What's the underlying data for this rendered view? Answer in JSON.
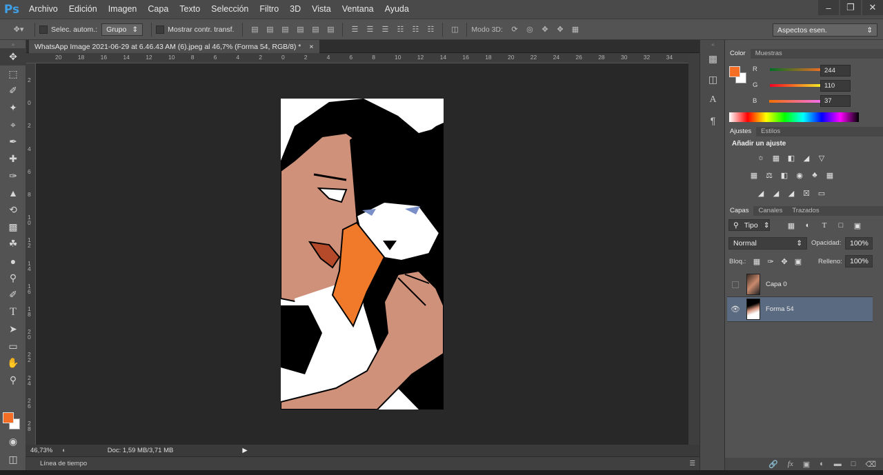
{
  "app": {
    "logo": "Ps"
  },
  "menu": [
    "Archivo",
    "Edición",
    "Imagen",
    "Capa",
    "Texto",
    "Selección",
    "Filtro",
    "3D",
    "Vista",
    "Ventana",
    "Ayuda"
  ],
  "window_controls": [
    "minimize-icon",
    "restore-icon",
    "close-icon"
  ],
  "options": {
    "auto_select_label": "Selec. autom.:",
    "auto_select_value": "Grupo",
    "transform_label": "Mostrar contr. transf.",
    "mode3d_label": "Modo 3D:",
    "workspace": "Aspectos esen."
  },
  "document": {
    "tab_title": "WhatsApp Image 2021-06-29 at 6.46.43 AM (6).jpeg al 46,7% (Forma 54, RGB/8) *",
    "zoom": "46,73%",
    "doc_size": "Doc: 1,59 MB/3,71 MB",
    "ruler_top": [
      "20",
      "18",
      "16",
      "14",
      "12",
      "10",
      "8",
      "6",
      "4",
      "2",
      "0",
      "2",
      "4",
      "6",
      "8",
      "10",
      "12",
      "14",
      "16",
      "18",
      "20",
      "22",
      "24",
      "26",
      "28",
      "30",
      "32",
      "34"
    ],
    "ruler_left": [
      "2",
      "0",
      "2",
      "4",
      "6",
      "8",
      "1 0",
      "1 2",
      "1 4",
      "1 6",
      "1 8",
      "2 0",
      "2 2",
      "2 4",
      "2 6",
      "2 8"
    ]
  },
  "timeline_label": "Línea de tiempo",
  "color_panel": {
    "tabs": [
      "Color",
      "Muestras"
    ],
    "r_label": "R",
    "r_value": "244",
    "g_label": "G",
    "g_value": "110",
    "b_label": "B",
    "b_value": "37",
    "foreground": "#f46e25",
    "background": "#ffffff"
  },
  "adjustments_panel": {
    "tabs": [
      "Ajustes",
      "Estilos"
    ],
    "heading": "Añadir un ajuste"
  },
  "layers_panel": {
    "tabs": [
      "Capas",
      "Canales",
      "Trazados"
    ],
    "filter_kind": "Tipo",
    "blend_mode": "Normal",
    "opacity_label": "Opacidad:",
    "opacity_value": "100%",
    "lock_label": "Bloq.:",
    "fill_label": "Relleno:",
    "fill_value": "100%",
    "layers": [
      {
        "name": "Capa 0",
        "visible": false,
        "selected": false
      },
      {
        "name": "Forma 54",
        "visible": true,
        "selected": true
      }
    ]
  }
}
